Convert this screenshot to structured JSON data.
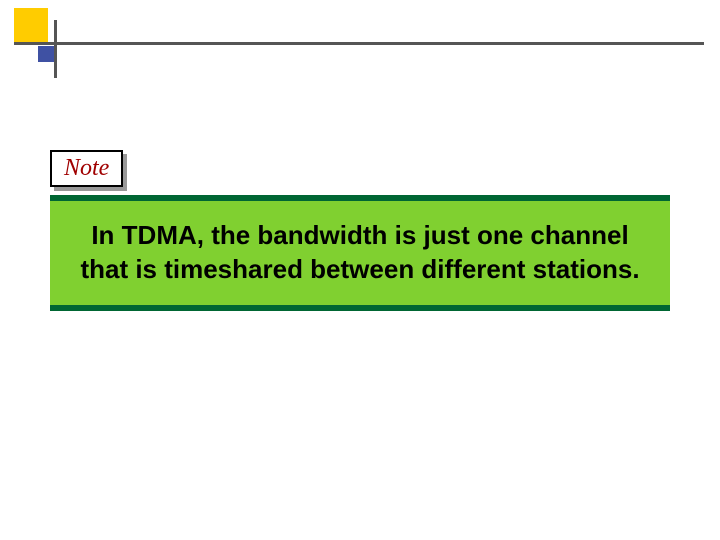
{
  "note": {
    "label": "Note",
    "text": "In TDMA, the bandwidth is just one channel that is timeshared between different stations."
  },
  "colors": {
    "accent_yellow": "#ffcc00",
    "accent_blue": "#3f51a3",
    "note_bg": "#80d030",
    "note_border": "#006633",
    "note_label_color": "#a00000"
  }
}
